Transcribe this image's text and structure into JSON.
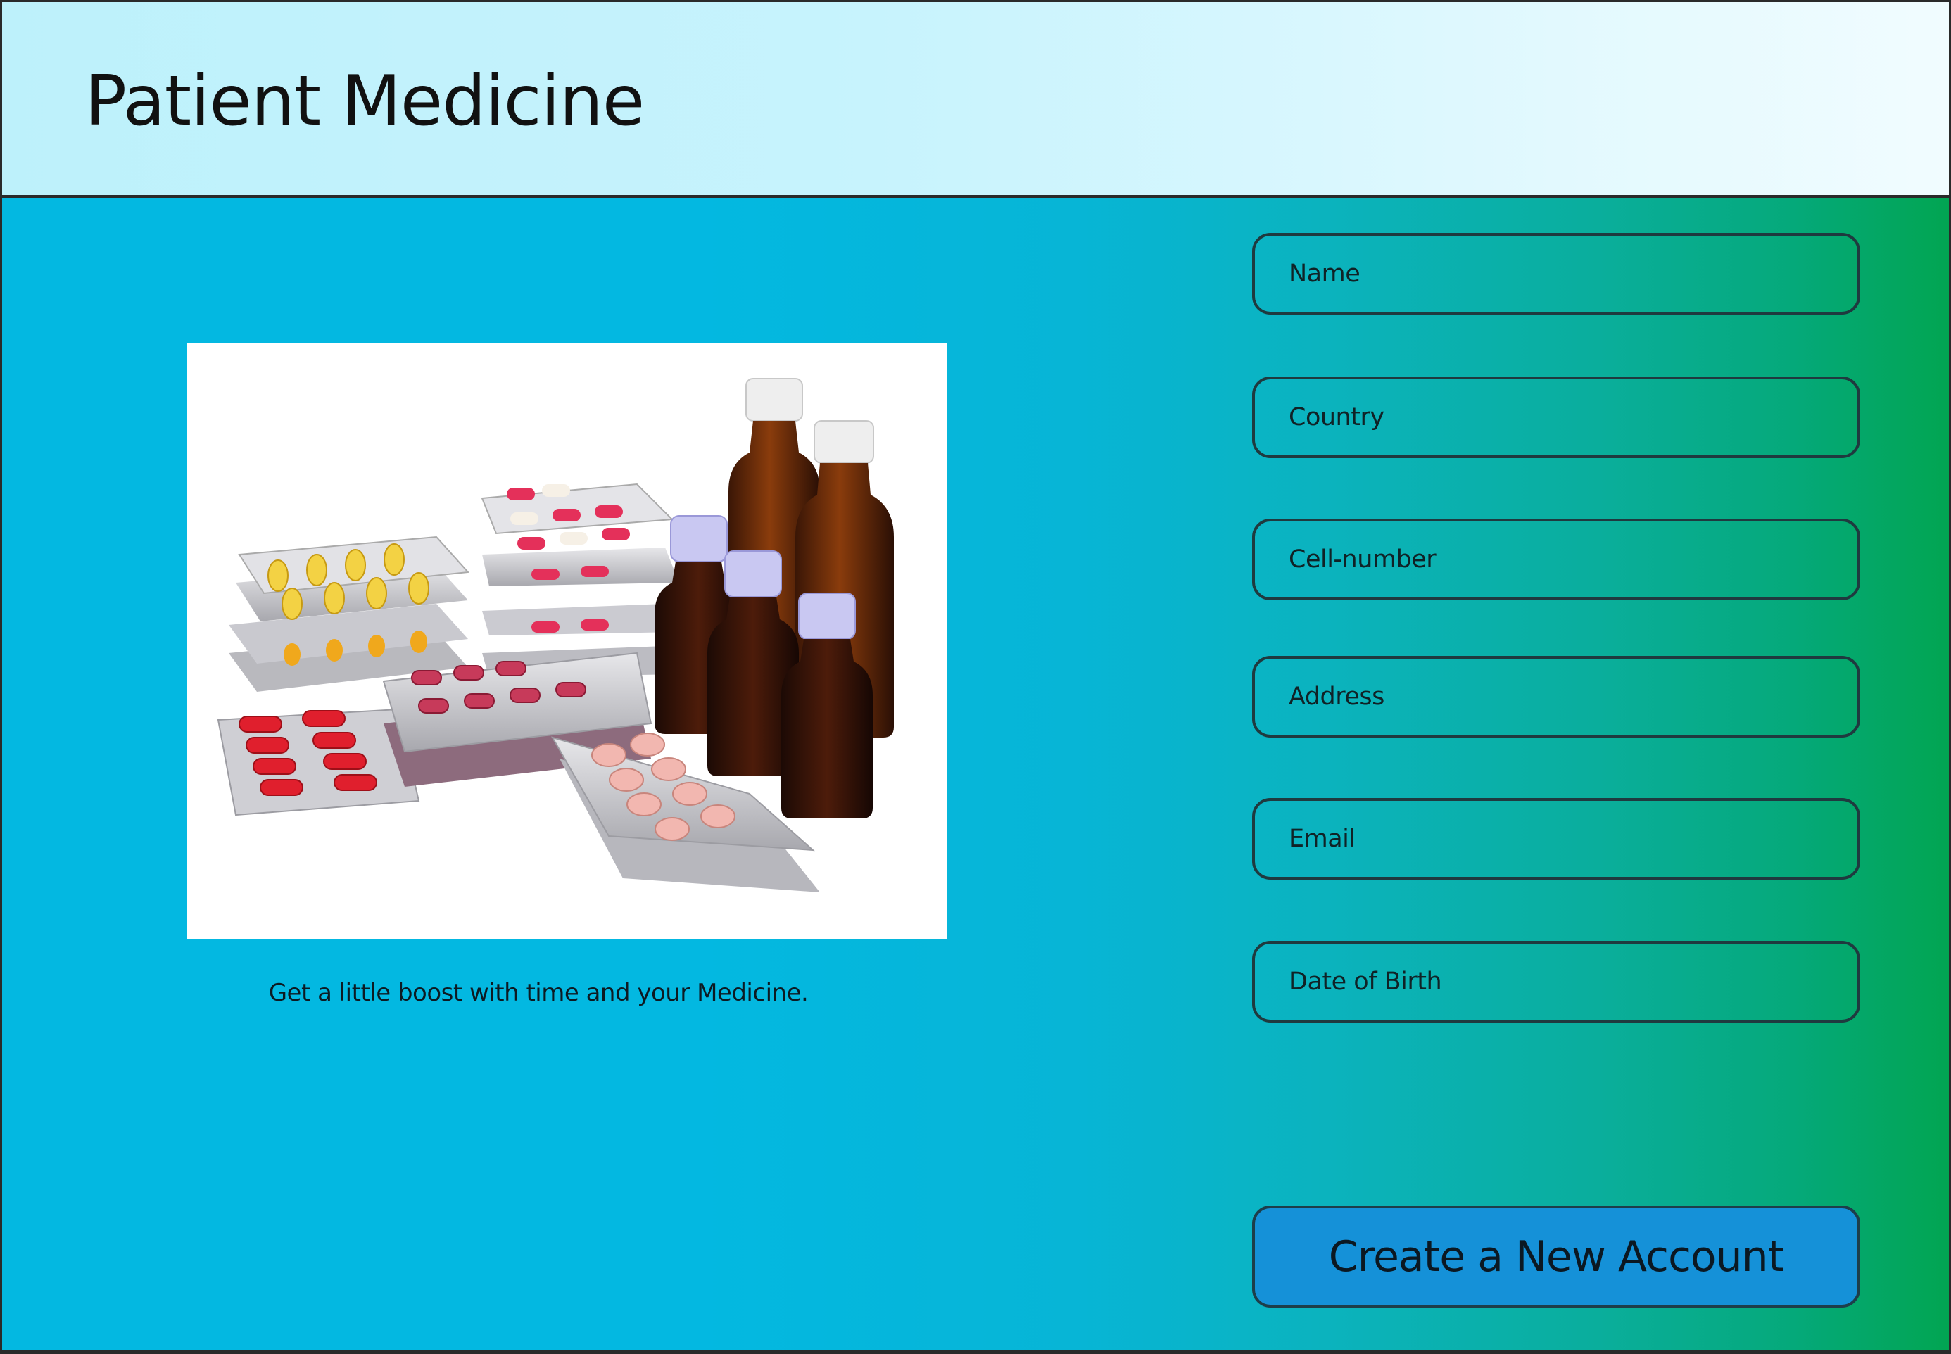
{
  "header": {
    "title": "Patient Medicine"
  },
  "hero": {
    "image_icon": "medicine-photo",
    "caption": "Get a little boost with time and your Medicine."
  },
  "form": {
    "fields": [
      {
        "label": "Name"
      },
      {
        "label": "Country"
      },
      {
        "label": "Cell-number"
      },
      {
        "label": "Address"
      },
      {
        "label": "Email"
      },
      {
        "label": "Date of Birth"
      }
    ],
    "submit_label": "Create a New Account"
  },
  "colors": {
    "header_bg": "#c7f3fd",
    "main_bg_left": "#03b8e1",
    "main_bg_right": "#02a552",
    "button_bg": "#1591d8",
    "border": "#1f3a3f"
  }
}
